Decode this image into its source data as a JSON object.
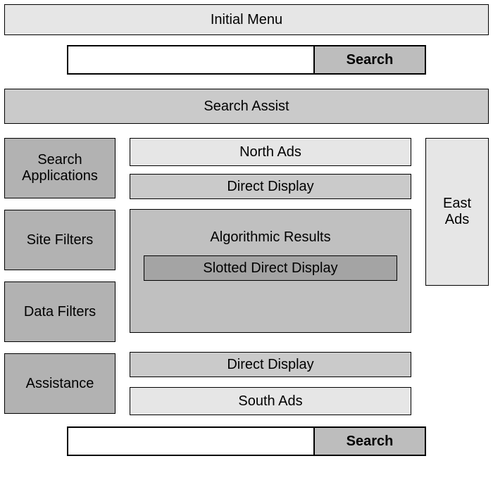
{
  "header": {
    "initial_menu": "Initial Menu"
  },
  "search_top": {
    "label": "Search"
  },
  "search_assist": "Search Assist",
  "left": {
    "search_applications": "Search\nApplications",
    "site_filters": "Site Filters",
    "data_filters": "Data Filters",
    "assistance": "Assistance"
  },
  "center": {
    "north_ads": "North Ads",
    "direct_display_top": "Direct Display",
    "algorithmic_results": "Algorithmic Results",
    "slotted_direct_display": "Slotted Direct Display",
    "direct_display_bottom": "Direct Display",
    "south_ads": "South Ads"
  },
  "right": {
    "east_ads": "East\nAds"
  },
  "search_bottom": {
    "label": "Search"
  }
}
